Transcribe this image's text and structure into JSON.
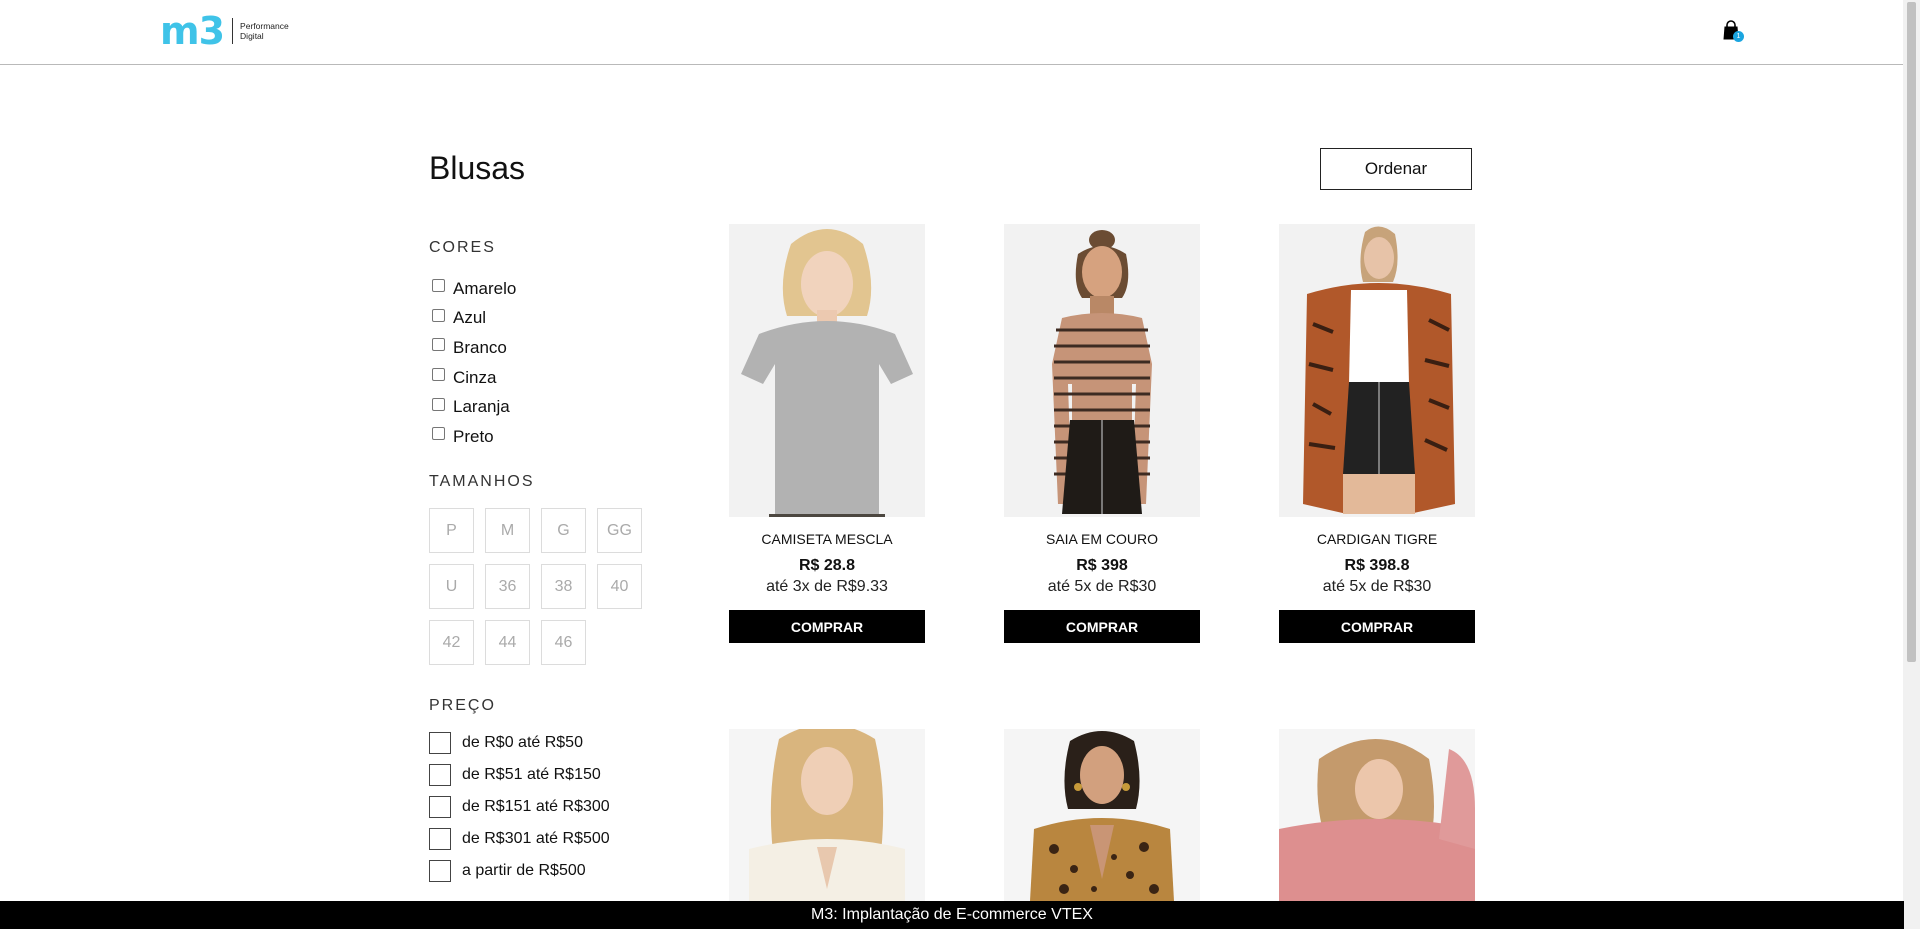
{
  "header": {
    "logo_mark": "m3",
    "logo_tagline_1": "Performance",
    "logo_tagline_2": "Digital",
    "cart_count": "1"
  },
  "page": {
    "title": "Blusas",
    "sort_label": "Ordenar"
  },
  "filters": {
    "colors_title": "CORES",
    "colors": [
      "Amarelo",
      "Azul",
      "Branco",
      "Cinza",
      "Laranja",
      "Preto"
    ],
    "sizes_title": "TAMANHOS",
    "sizes": [
      "P",
      "M",
      "G",
      "GG",
      "U",
      "36",
      "38",
      "40",
      "42",
      "44",
      "46"
    ],
    "price_title": "PREÇO",
    "prices": [
      "de R$0 até R$50",
      "de R$51 até R$150",
      "de R$151 até R$300",
      "de R$301 até R$500",
      "a partir de R$500"
    ]
  },
  "products": [
    {
      "name": "CAMISETA MESCLA",
      "price": "R$ 28.8",
      "installments": "até 3x de R$9.33",
      "buy_label": "COMPRAR"
    },
    {
      "name": "SAIA EM COURO",
      "price": "R$ 398",
      "installments": "até 5x de R$30",
      "buy_label": "COMPRAR"
    },
    {
      "name": "CARDIGAN TIGRE",
      "price": "R$ 398.8",
      "installments": "até 5x de R$30",
      "buy_label": "COMPRAR"
    }
  ],
  "footer": {
    "text": "M3: Implantação de E-commerce VTEX"
  }
}
